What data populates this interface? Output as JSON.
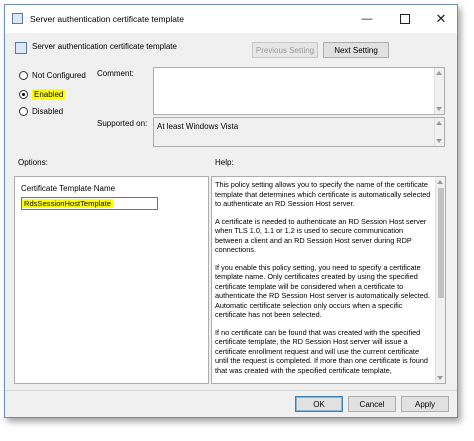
{
  "window": {
    "title": "Server authentication certificate template",
    "header_title": "Server authentication certificate template"
  },
  "nav": {
    "previous_label": "Previous Setting",
    "next_label": "Next Setting"
  },
  "state": {
    "not_configured_label": "Not Configured",
    "enabled_label": "Enabled",
    "disabled_label": "Disabled",
    "selected": "Enabled"
  },
  "comment": {
    "label": "Comment:",
    "value": ""
  },
  "supported": {
    "label": "Supported on:",
    "value": "At least Windows Vista"
  },
  "options": {
    "label": "Options:",
    "field_label": "Certificate Template Name",
    "field_value": "RdsSessionHostTemplate"
  },
  "help": {
    "label": "Help:",
    "paragraphs": [
      "This policy setting allows you to specify the name of the certificate template that determines which certificate is automatically selected to authenticate an RD Session Host server.",
      "A certificate is needed to authenticate an RD Session Host server when TLS 1.0, 1.1 or 1.2 is used to secure communication between a client and an RD Session Host server during RDP connections.",
      "If you enable this policy setting, you need to specify a certificate template name. Only certificates created by using the specified certificate template will be considered when a certificate to authenticate the RD Session Host server is automatically selected. Automatic certificate selection only occurs when a specific certificate has not been selected.",
      "If no certificate can be found that was created with the specified certificate template, the RD Session Host server will issue a certificate enrollment request and will use the current certificate until the request is completed. If more than one certificate is found that was created with the specified certificate template,"
    ]
  },
  "footer": {
    "ok_label": "OK",
    "cancel_label": "Cancel",
    "apply_label": "Apply"
  },
  "colors": {
    "highlight": "#ffff00",
    "accent": "#3c7fb1"
  },
  "icons": [
    "policy-icon",
    "minimize-icon",
    "maximize-icon",
    "close-icon"
  ]
}
